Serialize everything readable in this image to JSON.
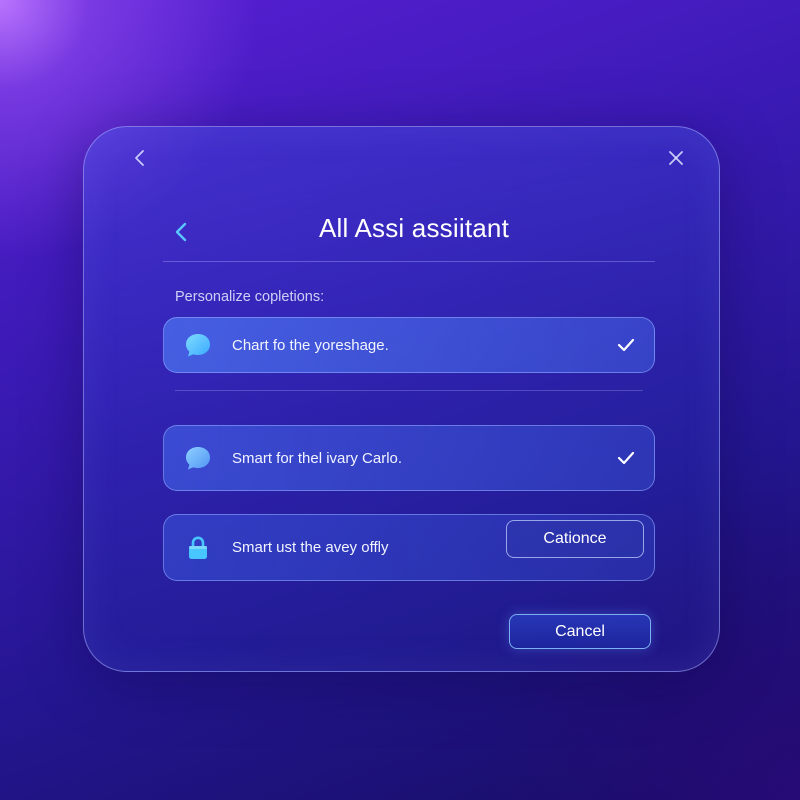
{
  "window": {
    "back_icon": "chevron-left-icon",
    "close_icon": "close-icon"
  },
  "header": {
    "back_icon": "chevron-left-icon",
    "title": "All Assi assiitant"
  },
  "section": {
    "label": "Personalize copletions:"
  },
  "options": [
    {
      "icon": "chat-bubble-icon",
      "label": "Chart fo the yoreshage.",
      "checked": true
    },
    {
      "icon": "chat-bubble-icon",
      "label": "Smart for thel ivary Carlo.",
      "checked": true
    },
    {
      "icon": "lock-icon",
      "label": "Smart ust the avey offly",
      "button_label": "Cationce"
    }
  ],
  "footer": {
    "cancel_label": "Cancel"
  },
  "colors": {
    "accent_cyan": "#5ac8ff",
    "text": "#ffffff",
    "background_top": "#5a1fd6",
    "background_bottom": "#160d63"
  }
}
